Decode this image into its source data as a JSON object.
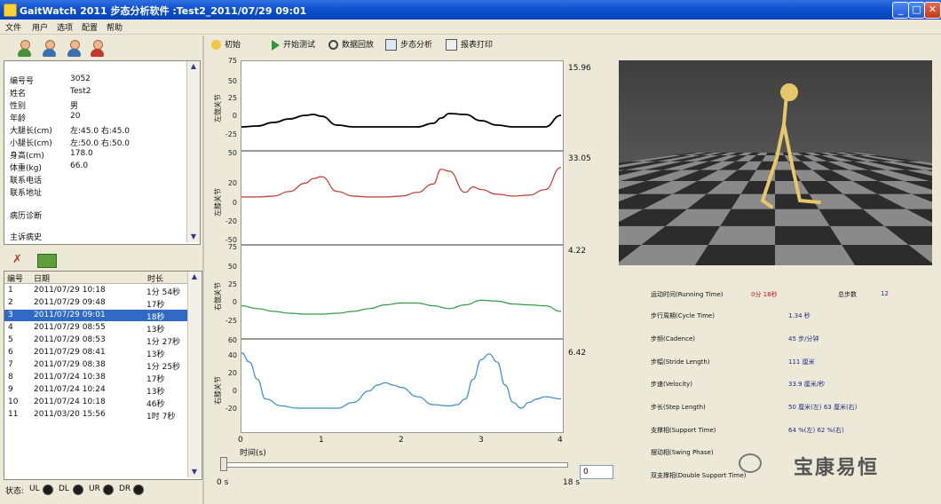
{
  "window": {
    "title": "GaitWatch 2011 步态分析软件 :Test2_2011/07/29 09:01"
  },
  "menu": [
    {
      "label": "文件"
    },
    {
      "label": "用户"
    },
    {
      "label": "选项"
    },
    {
      "label": "配置"
    },
    {
      "label": "帮助"
    }
  ],
  "toolbar": {
    "items": [
      {
        "label": "初始",
        "icon": "init-icon"
      },
      {
        "label": "开始测试",
        "icon": "play-icon"
      },
      {
        "label": "数据回放",
        "icon": "replay-icon"
      },
      {
        "label": "步态分析",
        "icon": "analysis-icon"
      },
      {
        "label": "报表打印",
        "icon": "print-icon"
      }
    ]
  },
  "patient": {
    "fields": [
      {
        "key": "编号号",
        "value": "3052"
      },
      {
        "key": "姓名",
        "value": "Test2"
      },
      {
        "key": "性别",
        "value": "男"
      },
      {
        "key": "年龄",
        "value": "20"
      },
      {
        "key": "大腿长(cm)",
        "value": "左:45.0 右:45.0"
      },
      {
        "key": "小腿长(cm)",
        "value": "左:50.0 右:50.0"
      },
      {
        "key": "身高(cm)",
        "value": "178.0"
      },
      {
        "key": "体重(kg)",
        "value": "66.0"
      },
      {
        "key": "联系电话",
        "value": ""
      },
      {
        "key": "联系地址",
        "value": ""
      },
      {
        "key": "病历诊断",
        "value": ""
      },
      {
        "key": "主诉病史",
        "value": ""
      }
    ]
  },
  "records": {
    "headers": [
      "编号",
      "日期",
      "时长"
    ],
    "rows": [
      {
        "no": "1",
        "date": "2011/07/29 10:18",
        "dur": "1分 54秒"
      },
      {
        "no": "2",
        "date": "2011/07/29 09:48",
        "dur": "17秒"
      },
      {
        "no": "3",
        "date": "2011/07/29 09:01",
        "dur": "18秒",
        "selected": true
      },
      {
        "no": "4",
        "date": "2011/07/29 08:55",
        "dur": "13秒"
      },
      {
        "no": "5",
        "date": "2011/07/29 08:53",
        "dur": "1分 27秒"
      },
      {
        "no": "6",
        "date": "2011/07/29 08:41",
        "dur": "13秒"
      },
      {
        "no": "7",
        "date": "2011/07/29 08:38",
        "dur": "1分 25秒"
      },
      {
        "no": "8",
        "date": "2011/07/24 10:38",
        "dur": "17秒"
      },
      {
        "no": "9",
        "date": "2011/07/24 10:24",
        "dur": "13秒"
      },
      {
        "no": "10",
        "date": "2011/07/24 10:18",
        "dur": "46秒"
      },
      {
        "no": "11",
        "date": "2011/03/20 15:56",
        "dur": "1时 7秒"
      }
    ]
  },
  "status": {
    "label": "状态:",
    "leds": [
      {
        "label": "UL"
      },
      {
        "label": "DL"
      },
      {
        "label": "UR"
      },
      {
        "label": "DR"
      }
    ]
  },
  "chart_data": [
    {
      "type": "line",
      "ylabel": "左髋关节",
      "ylim": [
        -25,
        75
      ],
      "yticks": [
        "75",
        "50",
        "25",
        "0",
        "-25"
      ],
      "max_label": "15.96",
      "color": "#000000",
      "x": [
        0,
        0.2,
        0.4,
        0.6,
        0.8,
        0.9,
        1.0,
        1.2,
        1.4,
        1.6,
        1.8,
        2.0,
        2.2,
        2.4,
        2.5,
        2.6,
        2.8,
        3.0,
        3.2,
        3.4,
        3.6,
        3.8,
        4.0
      ],
      "series": [
        {
          "values": [
            0,
            1,
            5,
            9,
            13,
            14,
            12,
            2,
            0,
            0,
            0,
            0,
            0,
            4,
            10,
            15,
            14,
            7,
            2,
            0,
            0,
            0,
            13
          ]
        }
      ]
    },
    {
      "type": "line",
      "ylabel": "左膝关节",
      "ylim": [
        -50,
        50
      ],
      "yticks": [
        "50",
        "20",
        "0",
        "-20",
        "-50"
      ],
      "max_label": "33.05",
      "color": "#c0392b",
      "x": [
        0,
        0.2,
        0.4,
        0.6,
        0.8,
        0.9,
        1.0,
        1.2,
        1.4,
        1.6,
        1.8,
        2.0,
        2.2,
        2.4,
        2.5,
        2.6,
        2.8,
        2.9,
        3.0,
        3.2,
        3.4,
        3.6,
        3.8,
        4.0
      ],
      "series": [
        {
          "values": [
            0,
            0,
            1,
            6,
            15,
            20,
            22,
            6,
            1,
            0,
            0,
            1,
            5,
            14,
            30,
            28,
            5,
            11,
            8,
            3,
            1,
            2,
            8,
            32
          ]
        }
      ]
    },
    {
      "type": "line",
      "ylabel": "右髋关节",
      "ylim": [
        -25,
        75
      ],
      "yticks": [
        "75",
        "50",
        "25",
        "0",
        "-25"
      ],
      "max_label": "4.22",
      "color": "#2e9e44",
      "x": [
        0,
        0.2,
        0.4,
        0.6,
        0.8,
        1.0,
        1.2,
        1.4,
        1.6,
        1.8,
        2.0,
        2.2,
        2.4,
        2.6,
        2.8,
        3.0,
        3.2,
        3.4,
        3.6,
        3.8,
        4.0
      ],
      "series": [
        {
          "values": [
            9,
            6,
            3,
            1,
            0,
            0,
            1,
            3,
            6,
            10,
            12,
            12,
            9,
            6,
            10,
            15,
            14,
            11,
            10,
            9,
            3
          ]
        }
      ]
    },
    {
      "type": "line",
      "ylabel": "右膝关节",
      "ylim": [
        -20,
        60
      ],
      "yticks": [
        "60",
        "40",
        "20",
        "0",
        "-20"
      ],
      "max_label": "6.42",
      "color": "#3a8fc4",
      "x": [
        0,
        0.1,
        0.2,
        0.3,
        0.5,
        0.7,
        0.9,
        1.0,
        1.1,
        1.2,
        1.4,
        1.6,
        1.7,
        1.8,
        1.9,
        2.0,
        2.2,
        2.4,
        2.6,
        2.7,
        2.8,
        2.9,
        3.0,
        3.1,
        3.2,
        3.3,
        3.4,
        3.5,
        3.6,
        3.7,
        3.8,
        4.0
      ],
      "series": [
        {
          "values": [
            48,
            40,
            25,
            8,
            2,
            0,
            0,
            0,
            0,
            0,
            5,
            15,
            20,
            22,
            20,
            18,
            10,
            3,
            2,
            3,
            8,
            25,
            42,
            47,
            40,
            20,
            5,
            0,
            5,
            8,
            10,
            8
          ]
        }
      ]
    }
  ],
  "xaxis": {
    "label": "时间(s)",
    "ticks": [
      "0",
      "1",
      "2",
      "3",
      "4"
    ]
  },
  "timeline": {
    "start_label": "0 s",
    "end_label": "18 s",
    "value_box": "0"
  },
  "metrics": {
    "running_time": {
      "label": "运动时间(Running Time)",
      "value": "0分 18秒"
    },
    "total_steps": {
      "label": "总步数",
      "value": "12"
    },
    "rows": [
      {
        "label": "步行周期(Cycle Time)",
        "value": "1.34 秒"
      },
      {
        "label": "步频(Cadence)",
        "value": "45 步/分钟"
      },
      {
        "label": "步幅(Stride Length)",
        "value": "111 厘米"
      },
      {
        "label": "步速(Velocity)",
        "value": "33.9 厘米/秒"
      },
      {
        "label": "步长(Step Length)",
        "value": "50 厘米(左) 63 厘米(右)"
      },
      {
        "label": "支撑相(Support Time)",
        "value": "64 %(左) 62 %(右)"
      },
      {
        "label": "摆动相(Swing Phase)",
        "value": ""
      },
      {
        "label": "双支撑相(Double Support Time)",
        "value": ""
      }
    ]
  },
  "watermark": {
    "text": "宝康易恒"
  }
}
